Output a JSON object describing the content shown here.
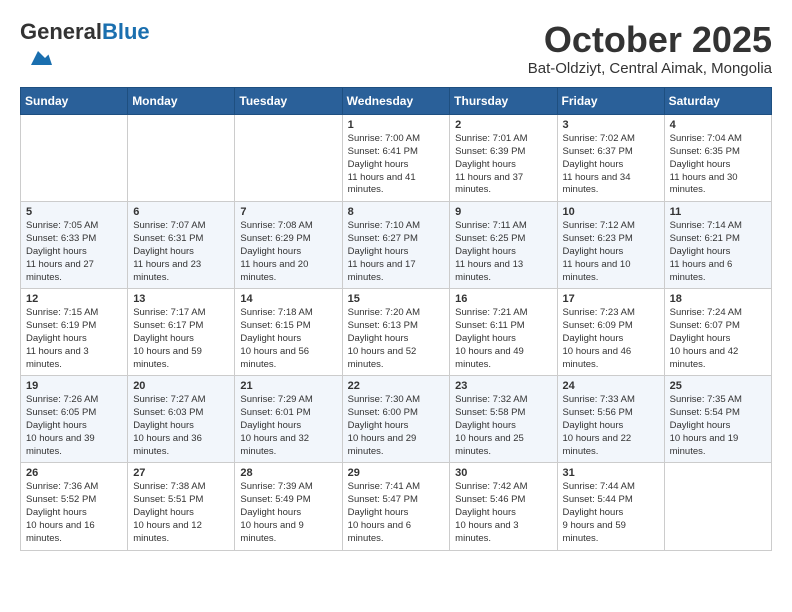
{
  "logo": {
    "general": "General",
    "blue": "Blue"
  },
  "header": {
    "month": "October 2025",
    "location": "Bat-Oldziyt, Central Aimak, Mongolia"
  },
  "weekdays": [
    "Sunday",
    "Monday",
    "Tuesday",
    "Wednesday",
    "Thursday",
    "Friday",
    "Saturday"
  ],
  "weeks": [
    [
      {
        "day": "",
        "empty": true
      },
      {
        "day": "",
        "empty": true
      },
      {
        "day": "",
        "empty": true
      },
      {
        "day": "1",
        "sunrise": "7:00 AM",
        "sunset": "6:41 PM",
        "daylight": "11 hours and 41 minutes."
      },
      {
        "day": "2",
        "sunrise": "7:01 AM",
        "sunset": "6:39 PM",
        "daylight": "11 hours and 37 minutes."
      },
      {
        "day": "3",
        "sunrise": "7:02 AM",
        "sunset": "6:37 PM",
        "daylight": "11 hours and 34 minutes."
      },
      {
        "day": "4",
        "sunrise": "7:04 AM",
        "sunset": "6:35 PM",
        "daylight": "11 hours and 30 minutes."
      }
    ],
    [
      {
        "day": "5",
        "sunrise": "7:05 AM",
        "sunset": "6:33 PM",
        "daylight": "11 hours and 27 minutes."
      },
      {
        "day": "6",
        "sunrise": "7:07 AM",
        "sunset": "6:31 PM",
        "daylight": "11 hours and 23 minutes."
      },
      {
        "day": "7",
        "sunrise": "7:08 AM",
        "sunset": "6:29 PM",
        "daylight": "11 hours and 20 minutes."
      },
      {
        "day": "8",
        "sunrise": "7:10 AM",
        "sunset": "6:27 PM",
        "daylight": "11 hours and 17 minutes."
      },
      {
        "day": "9",
        "sunrise": "7:11 AM",
        "sunset": "6:25 PM",
        "daylight": "11 hours and 13 minutes."
      },
      {
        "day": "10",
        "sunrise": "7:12 AM",
        "sunset": "6:23 PM",
        "daylight": "11 hours and 10 minutes."
      },
      {
        "day": "11",
        "sunrise": "7:14 AM",
        "sunset": "6:21 PM",
        "daylight": "11 hours and 6 minutes."
      }
    ],
    [
      {
        "day": "12",
        "sunrise": "7:15 AM",
        "sunset": "6:19 PM",
        "daylight": "11 hours and 3 minutes."
      },
      {
        "day": "13",
        "sunrise": "7:17 AM",
        "sunset": "6:17 PM",
        "daylight": "10 hours and 59 minutes."
      },
      {
        "day": "14",
        "sunrise": "7:18 AM",
        "sunset": "6:15 PM",
        "daylight": "10 hours and 56 minutes."
      },
      {
        "day": "15",
        "sunrise": "7:20 AM",
        "sunset": "6:13 PM",
        "daylight": "10 hours and 52 minutes."
      },
      {
        "day": "16",
        "sunrise": "7:21 AM",
        "sunset": "6:11 PM",
        "daylight": "10 hours and 49 minutes."
      },
      {
        "day": "17",
        "sunrise": "7:23 AM",
        "sunset": "6:09 PM",
        "daylight": "10 hours and 46 minutes."
      },
      {
        "day": "18",
        "sunrise": "7:24 AM",
        "sunset": "6:07 PM",
        "daylight": "10 hours and 42 minutes."
      }
    ],
    [
      {
        "day": "19",
        "sunrise": "7:26 AM",
        "sunset": "6:05 PM",
        "daylight": "10 hours and 39 minutes."
      },
      {
        "day": "20",
        "sunrise": "7:27 AM",
        "sunset": "6:03 PM",
        "daylight": "10 hours and 36 minutes."
      },
      {
        "day": "21",
        "sunrise": "7:29 AM",
        "sunset": "6:01 PM",
        "daylight": "10 hours and 32 minutes."
      },
      {
        "day": "22",
        "sunrise": "7:30 AM",
        "sunset": "6:00 PM",
        "daylight": "10 hours and 29 minutes."
      },
      {
        "day": "23",
        "sunrise": "7:32 AM",
        "sunset": "5:58 PM",
        "daylight": "10 hours and 25 minutes."
      },
      {
        "day": "24",
        "sunrise": "7:33 AM",
        "sunset": "5:56 PM",
        "daylight": "10 hours and 22 minutes."
      },
      {
        "day": "25",
        "sunrise": "7:35 AM",
        "sunset": "5:54 PM",
        "daylight": "10 hours and 19 minutes."
      }
    ],
    [
      {
        "day": "26",
        "sunrise": "7:36 AM",
        "sunset": "5:52 PM",
        "daylight": "10 hours and 16 minutes."
      },
      {
        "day": "27",
        "sunrise": "7:38 AM",
        "sunset": "5:51 PM",
        "daylight": "10 hours and 12 minutes."
      },
      {
        "day": "28",
        "sunrise": "7:39 AM",
        "sunset": "5:49 PM",
        "daylight": "10 hours and 9 minutes."
      },
      {
        "day": "29",
        "sunrise": "7:41 AM",
        "sunset": "5:47 PM",
        "daylight": "10 hours and 6 minutes."
      },
      {
        "day": "30",
        "sunrise": "7:42 AM",
        "sunset": "5:46 PM",
        "daylight": "10 hours and 3 minutes."
      },
      {
        "day": "31",
        "sunrise": "7:44 AM",
        "sunset": "5:44 PM",
        "daylight": "9 hours and 59 minutes."
      },
      {
        "day": "",
        "empty": true
      }
    ]
  ],
  "labels": {
    "sunrise": "Sunrise:",
    "sunset": "Sunset:",
    "daylight": "Daylight hours"
  }
}
